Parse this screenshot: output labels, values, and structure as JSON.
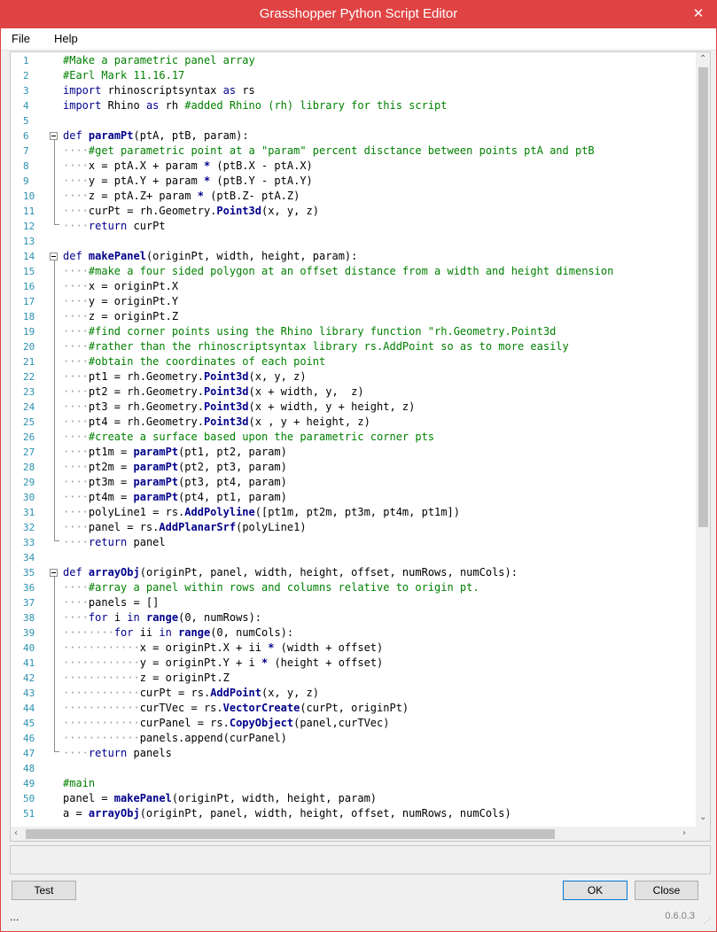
{
  "window": {
    "title": "Grasshopper Python Script Editor",
    "close_glyph": "✕"
  },
  "menu": [
    "File",
    "Help"
  ],
  "colors": {
    "titlebar": "#e04343",
    "line_numbers": "#2b91af",
    "comment": "#008000",
    "keyword": "#00008b",
    "function": "#00008b",
    "text": "#000000"
  },
  "code_lines": [
    {
      "n": "1",
      "text": "#Make a parametric panel array"
    },
    {
      "n": "2",
      "text": "#Earl Mark 11.16.17"
    },
    {
      "n": "3",
      "text": "import rhinoscriptsyntax as rs"
    },
    {
      "n": "4",
      "text": "import Rhino as rh #added Rhino (rh) library for this script"
    },
    {
      "n": "5",
      "text": ""
    },
    {
      "n": "6",
      "text": "def paramPt(ptA, ptB, param):"
    },
    {
      "n": "7",
      "text": "····#get parametric point at a \"param\" percent disctance between points ptA and ptB"
    },
    {
      "n": "8",
      "text": "····x = ptA.X + param * (ptB.X - ptA.X)"
    },
    {
      "n": "9",
      "text": "····y = ptA.Y + param * (ptB.Y - ptA.Y)"
    },
    {
      "n": "10",
      "text": "····z = ptA.Z+ param * (ptB.Z- ptA.Z)"
    },
    {
      "n": "11",
      "text": "····curPt = rh.Geometry.Point3d(x, y, z)"
    },
    {
      "n": "12",
      "text": "····return curPt"
    },
    {
      "n": "13",
      "text": ""
    },
    {
      "n": "14",
      "text": "def makePanel(originPt, width, height, param):"
    },
    {
      "n": "15",
      "text": "····#make a four sided polygon at an offset distance from a width and height dimension"
    },
    {
      "n": "16",
      "text": "····x = originPt.X"
    },
    {
      "n": "17",
      "text": "····y = originPt.Y"
    },
    {
      "n": "18",
      "text": "····z = originPt.Z"
    },
    {
      "n": "19",
      "text": "····#find corner points using the Rhino library function \"rh.Geometry.Point3d"
    },
    {
      "n": "20",
      "text": "····#rather than the rhinoscriptsyntax library rs.AddPoint so as to more easily"
    },
    {
      "n": "21",
      "text": "····#obtain the coordinates of each point"
    },
    {
      "n": "22",
      "text": "····pt1 = rh.Geometry.Point3d(x, y, z)"
    },
    {
      "n": "23",
      "text": "····pt2 = rh.Geometry.Point3d(x + width, y,  z)"
    },
    {
      "n": "24",
      "text": "····pt3 = rh.Geometry.Point3d(x + width, y + height, z)"
    },
    {
      "n": "25",
      "text": "····pt4 = rh.Geometry.Point3d(x , y + height, z)"
    },
    {
      "n": "26",
      "text": "····#create a surface based upon the parametric corner pts"
    },
    {
      "n": "27",
      "text": "····pt1m = paramPt(pt1, pt2, param)"
    },
    {
      "n": "28",
      "text": "····pt2m = paramPt(pt2, pt3, param)"
    },
    {
      "n": "29",
      "text": "····pt3m = paramPt(pt3, pt4, param)"
    },
    {
      "n": "30",
      "text": "····pt4m = paramPt(pt4, pt1, param)"
    },
    {
      "n": "31",
      "text": "····polyLine1 = rs.AddPolyline([pt1m, pt2m, pt3m, pt4m, pt1m])"
    },
    {
      "n": "32",
      "text": "····panel = rs.AddPlanarSrf(polyLine1)"
    },
    {
      "n": "33",
      "text": "····return panel"
    },
    {
      "n": "34",
      "text": ""
    },
    {
      "n": "35",
      "text": "def arrayObj(originPt, panel, width, height, offset, numRows, numCols):"
    },
    {
      "n": "36",
      "text": "····#array a panel within rows and columns relative to origin pt."
    },
    {
      "n": "37",
      "text": "····panels = []"
    },
    {
      "n": "38",
      "text": "····for i in range(0, numRows):"
    },
    {
      "n": "39",
      "text": "········for ii in range(0, numCols):"
    },
    {
      "n": "40",
      "text": "············x = originPt.X + ii * (width + offset)"
    },
    {
      "n": "41",
      "text": "············y = originPt.Y + i * (height + offset)"
    },
    {
      "n": "42",
      "text": "············z = originPt.Z"
    },
    {
      "n": "43",
      "text": "············curPt = rs.AddPoint(x, y, z)"
    },
    {
      "n": "44",
      "text": "············curTVec = rs.VectorCreate(curPt, originPt)"
    },
    {
      "n": "45",
      "text": "············curPanel = rs.CopyObject(panel,curTVec)"
    },
    {
      "n": "46",
      "text": "············panels.append(curPanel)"
    },
    {
      "n": "47",
      "text": "····return panels"
    },
    {
      "n": "48",
      "text": ""
    },
    {
      "n": "49",
      "text": "#main"
    },
    {
      "n": "50",
      "text": "panel = makePanel(originPt, width, height, param)"
    },
    {
      "n": "51",
      "text": "a = arrayObj(originPt, panel, width, height, offset, numRows, numCols)"
    }
  ],
  "buttons": {
    "test": "Test",
    "ok": "OK",
    "close": "Close"
  },
  "footer": {
    "left": "...",
    "version": "0.6.0.3"
  }
}
